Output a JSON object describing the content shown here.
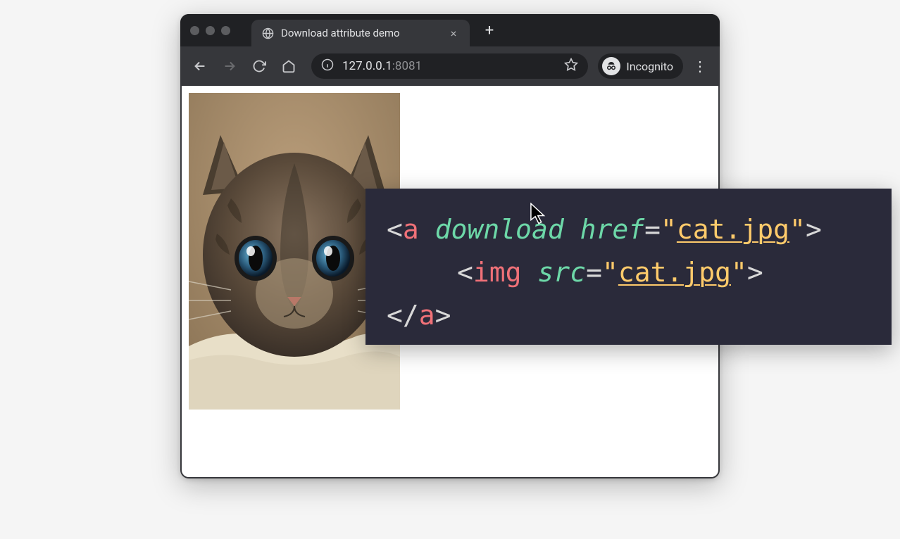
{
  "window": {
    "tab_title": "Download attribute demo",
    "url_host": "127.0.0.1",
    "url_port": ":8081",
    "incognito_label": "Incognito"
  },
  "code": {
    "line1": {
      "open_bracket": "<",
      "tag": "a",
      "attr1": "download",
      "attr2": "href",
      "eq": "=",
      "q1": "\"",
      "val": "cat.jpg",
      "q2": "\"",
      "close_bracket": ">"
    },
    "line2": {
      "open_bracket": "<",
      "tag": "img",
      "attr": "src",
      "eq": "=",
      "q1": "\"",
      "val": "cat.jpg",
      "q2": "\"",
      "close_bracket": ">"
    },
    "line3": {
      "open": "</",
      "tag": "a",
      "close": ">"
    }
  },
  "icons": {
    "tab_favicon": "globe-icon",
    "close": "×",
    "new_tab": "+",
    "menu": "⋮"
  }
}
